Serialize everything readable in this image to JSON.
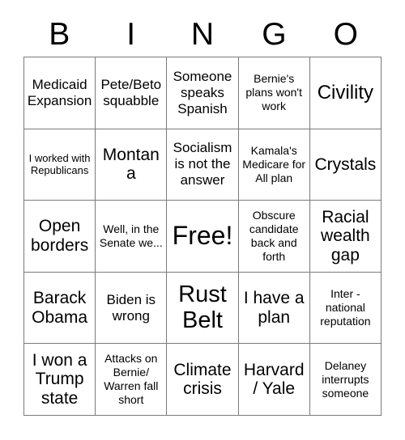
{
  "card": {
    "title": "BINGO",
    "header_letters": [
      "B",
      "I",
      "N",
      "G",
      "O"
    ],
    "grid_size": 5,
    "colors": {
      "background": "#ffffff",
      "text": "#000000",
      "grid_line": "#7a7a7a"
    },
    "cells": [
      [
        {
          "text": "Medicaid Expansion",
          "size": "sm",
          "marked": false
        },
        {
          "text": "Pete/Beto squabble",
          "size": "sm",
          "marked": false
        },
        {
          "text": "Someone speaks Spanish",
          "size": "sm",
          "marked": false
        },
        {
          "text": "Bernie's plans won't work",
          "size": "xs",
          "marked": false
        },
        {
          "text": "Civility",
          "size": "lg",
          "marked": false
        }
      ],
      [
        {
          "text": "I worked with Republicans",
          "size": "xxs",
          "marked": false
        },
        {
          "text": "Montana",
          "size": "md",
          "marked": false
        },
        {
          "text": "Socialism is not the answer",
          "size": "sm",
          "marked": false
        },
        {
          "text": "Kamala's Medicare for All plan",
          "size": "xs",
          "marked": false
        },
        {
          "text": "Crystals",
          "size": "md",
          "marked": false
        }
      ],
      [
        {
          "text": "Open borders",
          "size": "md",
          "marked": false
        },
        {
          "text": "Well, in the Senate we...",
          "size": "xs",
          "marked": false
        },
        {
          "text": "Free!",
          "size": "xxl",
          "marked": false
        },
        {
          "text": "Obscure candidate back and forth",
          "size": "xs",
          "marked": false
        },
        {
          "text": "Racial wealth gap",
          "size": "md",
          "marked": false
        }
      ],
      [
        {
          "text": "Barack Obama",
          "size": "md",
          "marked": false
        },
        {
          "text": "Biden is wrong",
          "size": "sm",
          "marked": false
        },
        {
          "text": "Rust Belt",
          "size": "xl",
          "marked": false
        },
        {
          "text": "I have a plan",
          "size": "md",
          "marked": false
        },
        {
          "text": "Inter - national reputation",
          "size": "xs",
          "marked": false
        }
      ],
      [
        {
          "text": "I won a Trump state",
          "size": "md",
          "marked": false
        },
        {
          "text": "Attacks on Bernie/ Warren fall short",
          "size": "xs",
          "marked": false
        },
        {
          "text": "Climate crisis",
          "size": "md",
          "marked": false
        },
        {
          "text": "Harvard / Yale",
          "size": "md",
          "marked": false
        },
        {
          "text": "Delaney interrupts someone",
          "size": "xs",
          "marked": false
        }
      ]
    ]
  }
}
